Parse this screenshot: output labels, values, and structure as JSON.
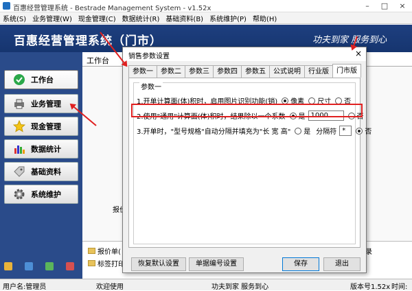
{
  "window": {
    "title": "百惠经营管理系统 - Bestrade Management System - v1.52x",
    "minimize": "–",
    "maximize": "□",
    "close": "×"
  },
  "menu": [
    "系统(S)",
    "业务管理(W)",
    "现金管理(C)",
    "数据统计(R)",
    "基础资料(B)",
    "系统维护(P)",
    "帮助(H)"
  ],
  "banner": {
    "title": "百惠经营管理系统（门市）",
    "slogan": "功夫到家 服务到心"
  },
  "sidebar": {
    "items": [
      {
        "label": "工作台",
        "icon": "check-icon"
      },
      {
        "label": "业务管理",
        "icon": "printer-icon"
      },
      {
        "label": "现金管理",
        "icon": "star-icon"
      },
      {
        "label": "数据统计",
        "icon": "bar-chart-icon"
      },
      {
        "label": "基础资料",
        "icon": "tag-icon"
      },
      {
        "label": "系统维护",
        "icon": "gear-icon"
      }
    ]
  },
  "main": {
    "tab_label": "工作台",
    "list": [
      "报价单(",
      "标签打印"
    ],
    "side_text_1": "报价",
    "side_text_2": "录"
  },
  "dialog": {
    "title": "销售参数设置",
    "close": "×",
    "tabs": [
      "参数一",
      "参数二",
      "参数三",
      "参数四",
      "参数五",
      "公式说明",
      "行业版",
      "门市版"
    ],
    "selected_tab": "门市版",
    "group_title": "参数一",
    "row1": {
      "text": "1.开单计算面(体)积时，启用图片识别功能(销)",
      "options": [
        "像素",
        "尺寸",
        "否"
      ],
      "selected": "像素"
    },
    "row2": {
      "text": "2.使用\"通用\"计算面(体)积时，结果除以一个系数",
      "yes": "是",
      "value": "1000",
      "no": "否",
      "selected": "是"
    },
    "row3": {
      "text": "3.开单时，\"型号规格\"自动分隔并填充为\"长 宽 高\"",
      "yes": "是",
      "separator_label": "分隔符",
      "separator_value": "*",
      "no": "否",
      "selected": "否"
    },
    "buttons": {
      "restore": "恢复默认设置",
      "numbering": "单据编号设置",
      "save": "保存",
      "exit": "退出"
    }
  },
  "statusbar": {
    "user": "用户名:管理员",
    "welcome": "欢迎使用",
    "slogan": "功夫到家 服务到心",
    "version": "版本号1.52x",
    "date": "时间:"
  }
}
